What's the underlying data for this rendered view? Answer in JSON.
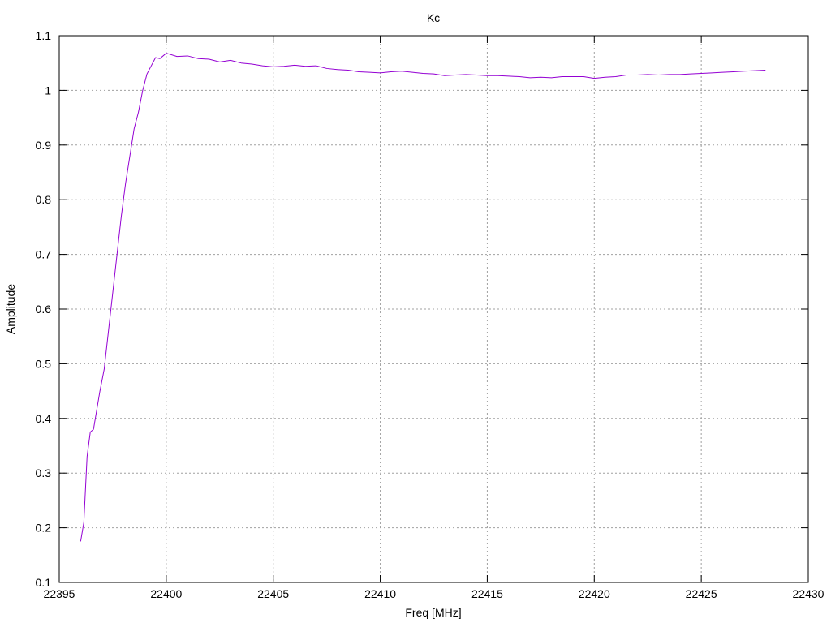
{
  "chart_data": {
    "type": "line",
    "title": "Kc",
    "xlabel": "Freq [MHz]",
    "ylabel": "Amplitude",
    "xlim": [
      22395,
      22430
    ],
    "ylim": [
      0.1,
      1.1
    ],
    "xticks": [
      22395,
      22400,
      22405,
      22410,
      22415,
      22420,
      22425,
      22430
    ],
    "yticks": [
      0.1,
      0.2,
      0.3,
      0.4,
      0.5,
      0.6,
      0.7,
      0.8,
      0.9,
      1,
      1.1
    ],
    "grid": true,
    "series": [
      {
        "color": "#9400d3",
        "x": [
          22396.0,
          22396.15,
          22396.3,
          22396.45,
          22396.6,
          22396.75,
          22396.9,
          22397.1,
          22397.3,
          22397.5,
          22397.7,
          22397.9,
          22398.1,
          22398.3,
          22398.5,
          22398.7,
          22398.9,
          22399.1,
          22399.3,
          22399.5,
          22399.7,
          22400.0,
          22400.5,
          22401.0,
          22401.5,
          22402.0,
          22402.5,
          22403.0,
          22403.5,
          22404.0,
          22404.5,
          22405.0,
          22405.5,
          22406.0,
          22406.5,
          22407.0,
          22407.5,
          22408.0,
          22408.5,
          22409.0,
          22409.5,
          22410.0,
          22410.5,
          22411.0,
          22411.5,
          22412.0,
          22412.5,
          22413.0,
          22413.5,
          22414.0,
          22414.5,
          22415.0,
          22415.5,
          22416.0,
          22416.5,
          22417.0,
          22417.5,
          22418.0,
          22418.5,
          22419.0,
          22419.5,
          22420.0,
          22420.5,
          22421.0,
          22421.5,
          22422.0,
          22422.5,
          22423.0,
          22423.5,
          22424.0,
          22424.5,
          22425.0,
          22425.5,
          22426.0,
          22426.5,
          22427.0,
          22427.5,
          22428.0
        ],
        "y": [
          0.175,
          0.21,
          0.33,
          0.375,
          0.38,
          0.415,
          0.45,
          0.49,
          0.56,
          0.63,
          0.7,
          0.77,
          0.83,
          0.88,
          0.93,
          0.96,
          1.0,
          1.03,
          1.045,
          1.06,
          1.058,
          1.068,
          1.062,
          1.063,
          1.058,
          1.057,
          1.052,
          1.055,
          1.05,
          1.048,
          1.045,
          1.043,
          1.044,
          1.046,
          1.044,
          1.045,
          1.04,
          1.038,
          1.037,
          1.034,
          1.033,
          1.032,
          1.034,
          1.035,
          1.033,
          1.031,
          1.03,
          1.027,
          1.028,
          1.029,
          1.028,
          1.027,
          1.027,
          1.026,
          1.025,
          1.023,
          1.024,
          1.023,
          1.025,
          1.025,
          1.025,
          1.022,
          1.024,
          1.025,
          1.028,
          1.028,
          1.029,
          1.028,
          1.029,
          1.029,
          1.03,
          1.031,
          1.032,
          1.033,
          1.034,
          1.035,
          1.036,
          1.037
        ]
      }
    ]
  }
}
